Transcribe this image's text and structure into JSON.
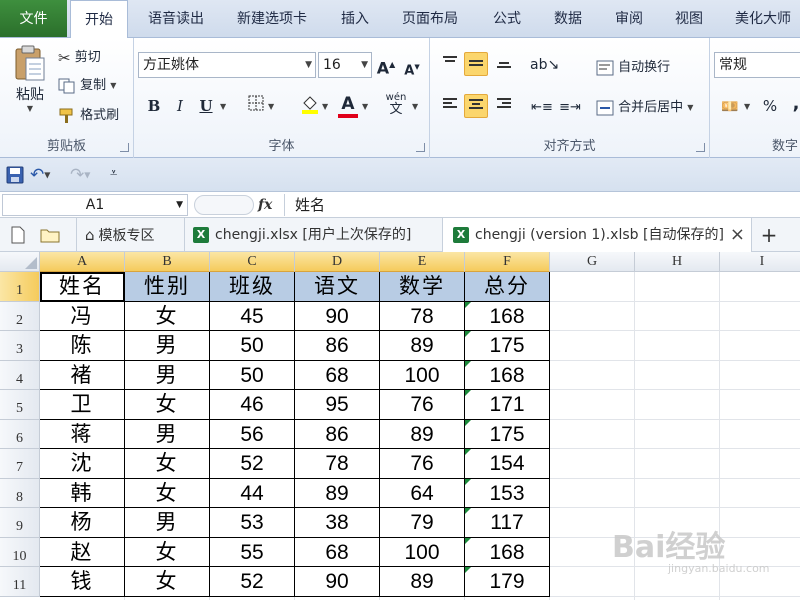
{
  "ribbon_tabs": [
    "文件",
    "开始",
    "语音读出",
    "新建选项卡",
    "插入",
    "页面布局",
    "公式",
    "数据",
    "审阅",
    "视图",
    "美化大师"
  ],
  "clipboard": {
    "paste": "粘贴",
    "cut": "剪切",
    "copy": "复制",
    "format_painter": "格式刷",
    "label": "剪贴板"
  },
  "font": {
    "name": "方正姚体",
    "size": "16",
    "grow": "A",
    "shrink": "A",
    "bold": "B",
    "italic": "I",
    "underline": "U",
    "wen": "wén",
    "label": "字体"
  },
  "alignment": {
    "wrap": "自动换行",
    "merge": "合并后居中",
    "label": "对齐方式"
  },
  "number": {
    "format": "常规",
    "percent": "%",
    "comma": ",",
    "label": "数字"
  },
  "formula_bar": {
    "name_box": "A1",
    "fx": "fx",
    "content": "姓名"
  },
  "doc_tabs": {
    "template": "模板专区",
    "file1": "chengji.xlsx [用户上次保存的]",
    "file2": "chengji (version 1).xlsb [自动保存的]",
    "close": "×",
    "add": "+"
  },
  "columns": [
    "A",
    "B",
    "C",
    "D",
    "E",
    "F",
    "G",
    "H",
    "I"
  ],
  "rows": [
    "1",
    "2",
    "3",
    "4",
    "5",
    "6",
    "7",
    "8",
    "9",
    "10",
    "11"
  ],
  "table": {
    "headers": [
      "姓名",
      "性别",
      "班级",
      "语文",
      "数学",
      "总分"
    ],
    "data": [
      [
        "冯",
        "女",
        "45",
        "90",
        "78",
        "168"
      ],
      [
        "陈",
        "男",
        "50",
        "86",
        "89",
        "175"
      ],
      [
        "褚",
        "男",
        "50",
        "68",
        "100",
        "168"
      ],
      [
        "卫",
        "女",
        "46",
        "95",
        "76",
        "171"
      ],
      [
        "蒋",
        "男",
        "56",
        "86",
        "89",
        "175"
      ],
      [
        "沈",
        "女",
        "52",
        "78",
        "76",
        "154"
      ],
      [
        "韩",
        "女",
        "44",
        "89",
        "64",
        "153"
      ],
      [
        "杨",
        "男",
        "53",
        "38",
        "79",
        "117"
      ],
      [
        "赵",
        "女",
        "55",
        "68",
        "100",
        "168"
      ],
      [
        "钱",
        "女",
        "52",
        "90",
        "89",
        "179"
      ]
    ]
  },
  "watermark": {
    "brand": "Bai经验",
    "url": "jingyan.baidu.com"
  },
  "colors": {
    "header_fill": "#b8cce4",
    "file_tab": "#2e7d32",
    "selection": "#f5cb5c"
  }
}
